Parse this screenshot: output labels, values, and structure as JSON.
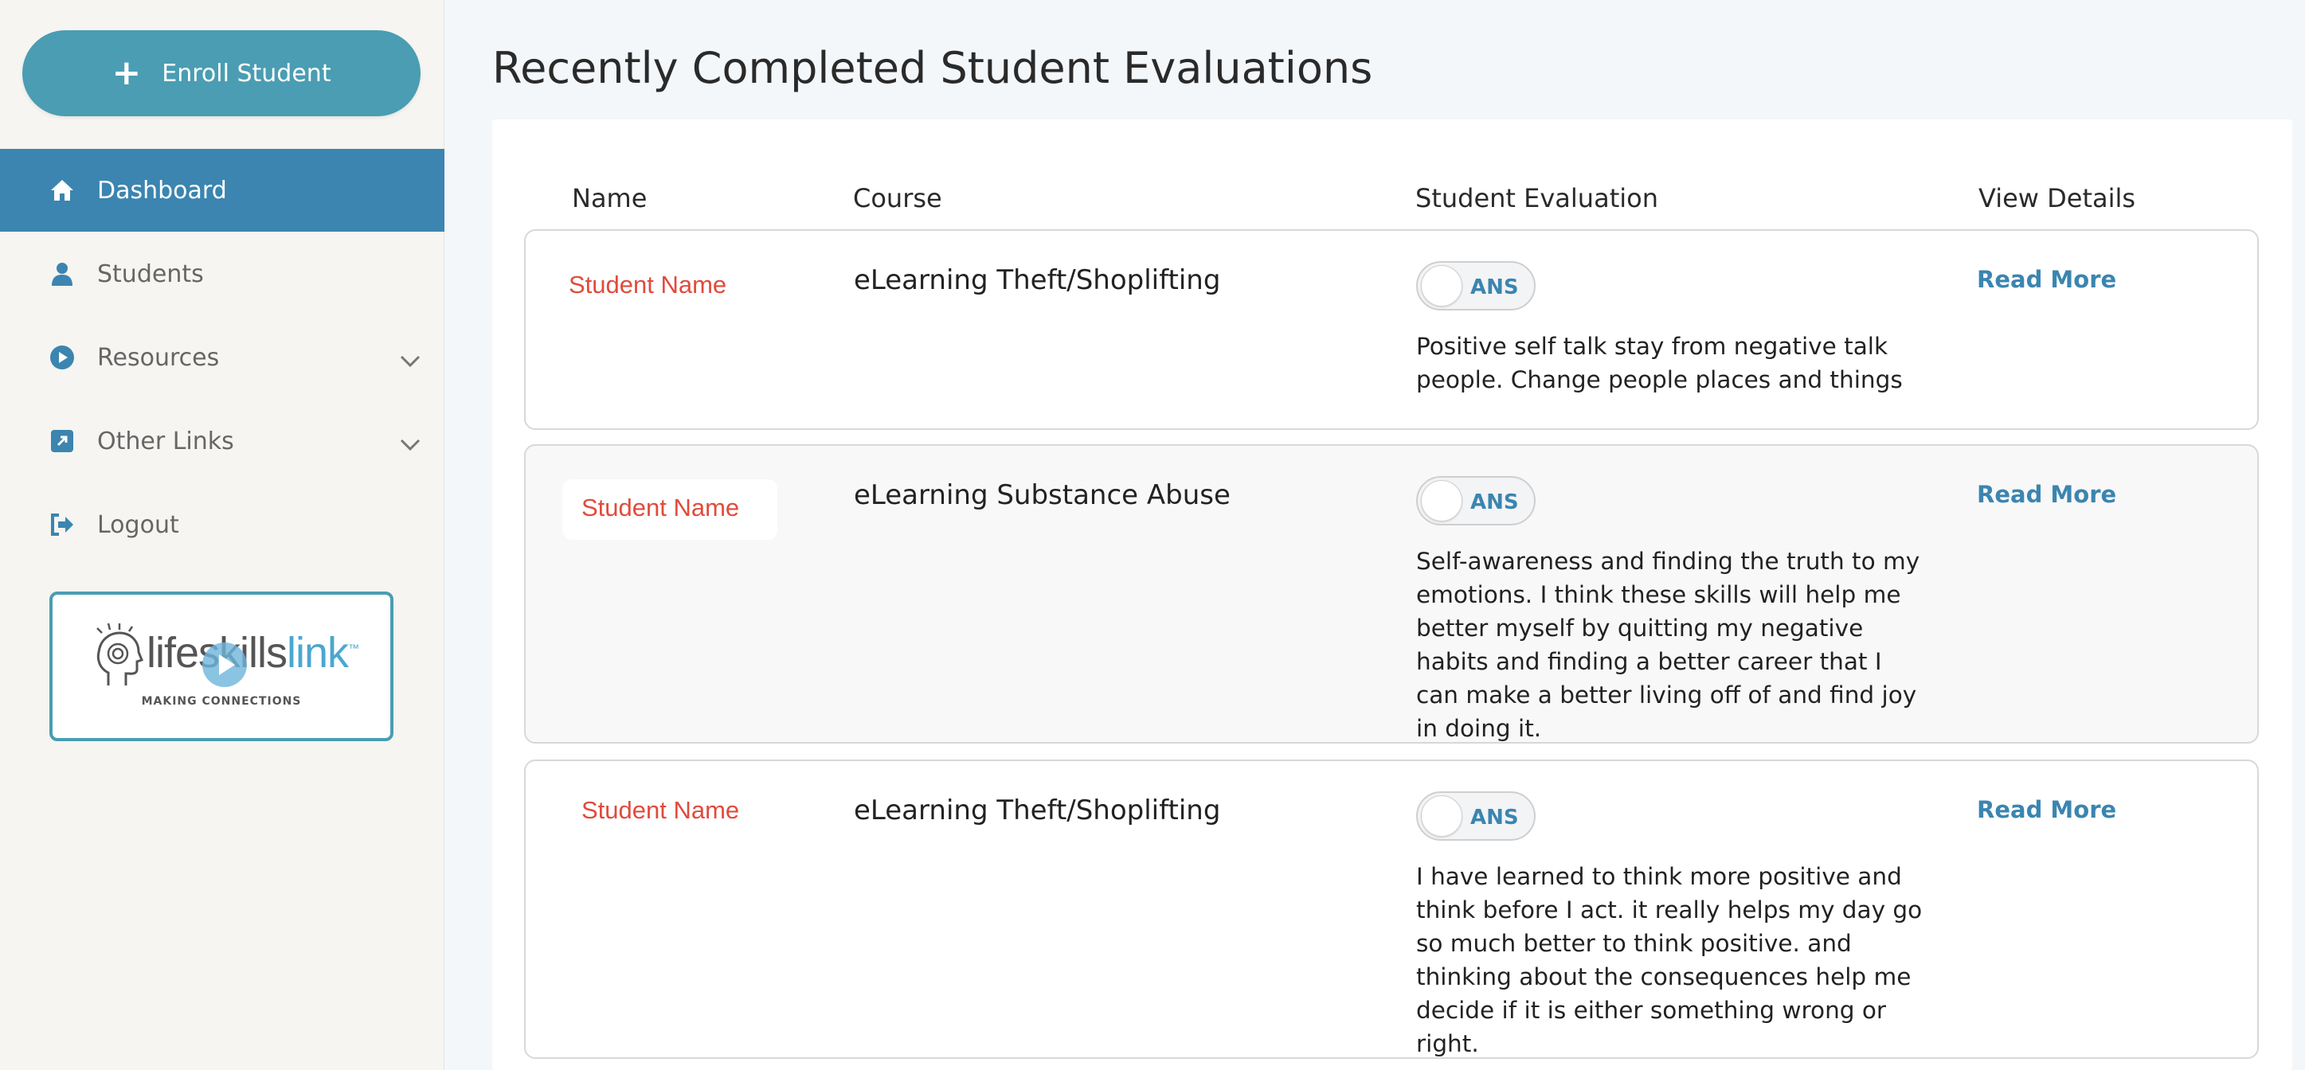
{
  "sidebar": {
    "enroll_label": "Enroll Student",
    "items": [
      {
        "label": "Dashboard",
        "icon": "home-icon",
        "active": true
      },
      {
        "label": "Students",
        "icon": "user-icon"
      },
      {
        "label": "Resources",
        "icon": "play-circle-icon",
        "expandable": true
      },
      {
        "label": "Other Links",
        "icon": "external-link-icon",
        "expandable": true
      },
      {
        "label": "Logout",
        "icon": "logout-icon"
      }
    ],
    "logo": {
      "word1": "lifeskills",
      "word2": "link",
      "tm": "™",
      "tagline": "MAKING CONNECTIONS"
    }
  },
  "main": {
    "title": "Recently Completed Student Evaluations",
    "columns": [
      "Name",
      "Course",
      "Student Evaluation",
      "View Details"
    ],
    "rows": [
      {
        "name": "Student Name",
        "course": "eLearning Theft/Shoplifting",
        "toggle_label": "ANS",
        "evaluation": "Positive self talk stay from negative talk people. Change people places and things",
        "link": "Read More"
      },
      {
        "name": "Student Name",
        "course": "eLearning Substance Abuse",
        "toggle_label": "ANS",
        "evaluation": "Self-awareness and finding the truth to my emotions. I think these skills will help me better myself by quitting my negative habits and finding a better career that I can make a better living off of and find joy in doing it.",
        "link": "Read More"
      },
      {
        "name": "Student Name",
        "course": "eLearning Theft/Shoplifting",
        "toggle_label": "ANS",
        "evaluation": "I have learned to think more positive and think before I act. it really helps my day go so much better to think positive. and thinking about the consequences help me decide if it is either something wrong or right.",
        "link": "Read More"
      }
    ]
  },
  "colors": {
    "accent": "#3b85b0",
    "button": "#4a9db2",
    "student_name": "#e04b3c"
  }
}
